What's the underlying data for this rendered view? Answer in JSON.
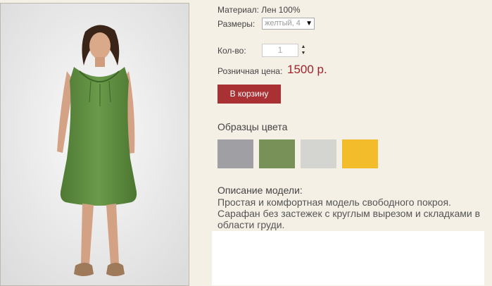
{
  "product": {
    "material": "Материал: Лен 100%",
    "sizes_label": "Размеры:",
    "sizes_value": "желтый, 4",
    "qty_label": "Кол-во:",
    "qty_value": "1",
    "price_label": "Розничная цена:",
    "price_value": "1500 р.",
    "cart_button": "В корзину"
  },
  "swatches": {
    "title": "Образцы цвета",
    "colors": [
      "#a09fa4",
      "#779158",
      "#d4d4d0",
      "#f3bc2a"
    ]
  },
  "description": {
    "title": "Описание модели:",
    "line1": "Простая и комфортная модель свободного покроя.",
    "line2": "Сарафан без застежек с круглым вырезом и складками в области груди."
  },
  "colors": {
    "price": "#a0222a",
    "cart_button": "#a93033",
    "background": "#f5f0e6"
  }
}
